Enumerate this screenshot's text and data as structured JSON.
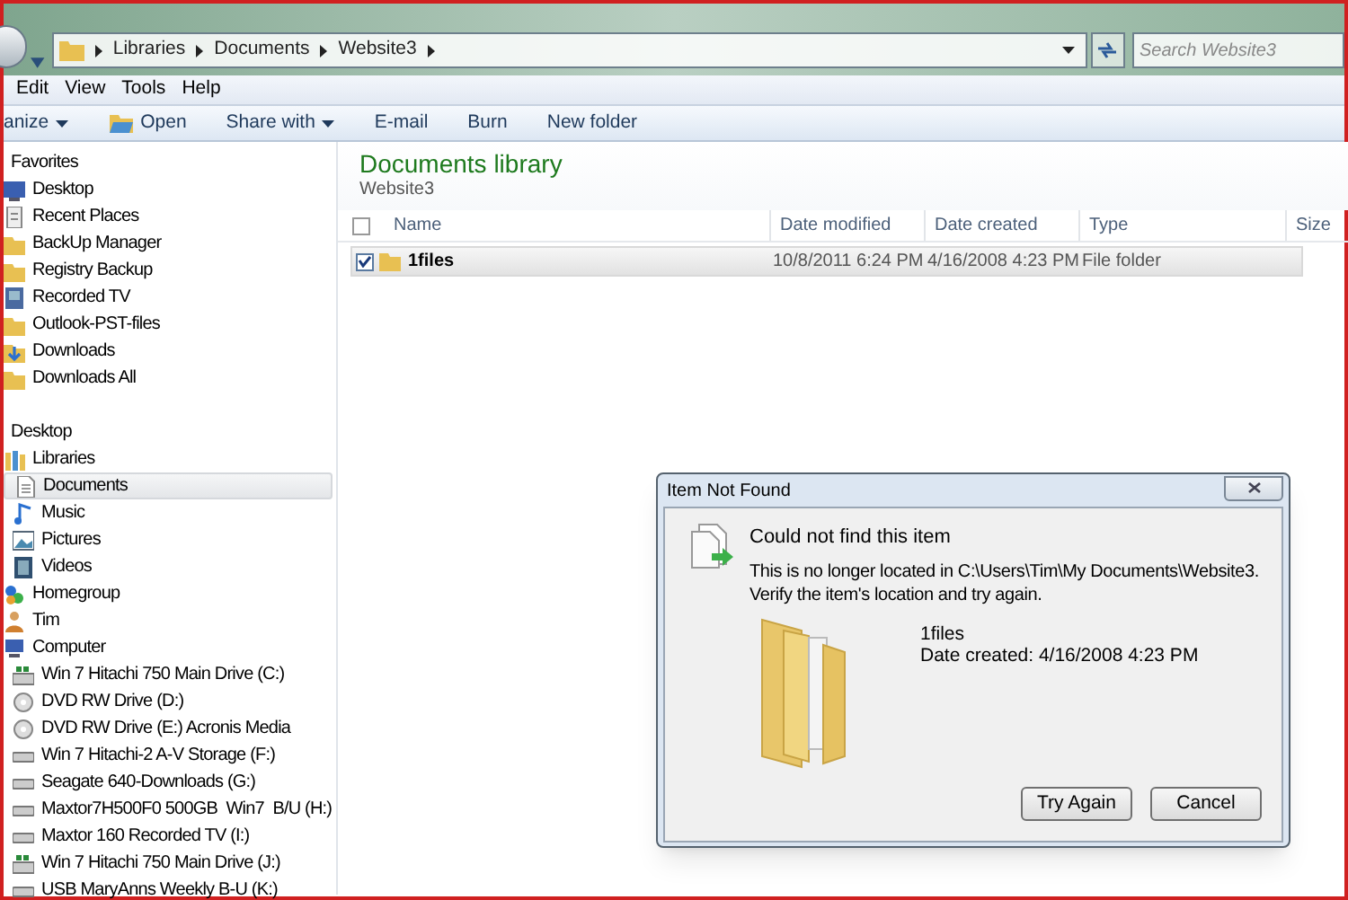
{
  "address_bar": {
    "crumbs": [
      "Libraries",
      "Documents",
      "Website3"
    ]
  },
  "search": {
    "placeholder": "Search Website3"
  },
  "menu_bar": [
    "Edit",
    "View",
    "Tools",
    "Help"
  ],
  "toolbar": [
    {
      "label": "anize",
      "dropdown": true,
      "kind": "plain"
    },
    {
      "label": "Open",
      "dropdown": false,
      "kind": "open"
    },
    {
      "label": "Share with",
      "dropdown": true,
      "kind": "plain"
    },
    {
      "label": "E-mail",
      "dropdown": false,
      "kind": "plain"
    },
    {
      "label": "Burn",
      "dropdown": false,
      "kind": "plain"
    },
    {
      "label": "New folder",
      "dropdown": false,
      "kind": "plain"
    }
  ],
  "sidebar": [
    {
      "label": "Favorites",
      "selected": false,
      "children": [
        {
          "label": "Desktop",
          "kind": "desktop",
          "selected": false
        },
        {
          "label": "Recent Places",
          "kind": "recent",
          "selected": false
        },
        {
          "label": "BackUp Manager",
          "kind": "folder",
          "selected": false
        },
        {
          "label": "Registry Backup",
          "kind": "folder",
          "selected": false
        },
        {
          "label": "Recorded TV",
          "kind": "tv",
          "selected": false
        },
        {
          "label": "Outlook-PST-files",
          "kind": "folder",
          "selected": false
        },
        {
          "label": "Downloads",
          "kind": "download",
          "selected": false
        },
        {
          "label": "Downloads All",
          "kind": "folder",
          "selected": false
        }
      ]
    },
    {
      "label": "Desktop",
      "selected": false,
      "children": [
        {
          "label": "Libraries",
          "kind": "library",
          "selected": false,
          "children": [
            {
              "label": "Documents",
              "kind": "document",
              "selected": true
            },
            {
              "label": "Music",
              "kind": "music",
              "selected": false
            },
            {
              "label": "Pictures",
              "kind": "picture",
              "selected": false
            },
            {
              "label": "Videos",
              "kind": "video",
              "selected": false
            }
          ]
        },
        {
          "label": "Homegroup",
          "kind": "network",
          "selected": false
        },
        {
          "label": "Tim",
          "kind": "user",
          "selected": false
        },
        {
          "label": "Computer",
          "kind": "computer",
          "selected": false,
          "children": [
            {
              "label": "Win 7 Hitachi 750 Main Drive (C:)",
              "kind": "system-drive",
              "selected": false
            },
            {
              "label": "DVD RW Drive (D:)",
              "kind": "disc",
              "selected": false
            },
            {
              "label": "DVD RW Drive (E:) Acronis Media",
              "kind": "disc",
              "selected": false
            },
            {
              "label": "Win 7 Hitachi-2 A-V Storage (F:)",
              "kind": "drive",
              "selected": false
            },
            {
              "label": "Seagate 640-Downloads (G:)",
              "kind": "drive",
              "selected": false
            },
            {
              "label": "Maxtor7H500F0 500GB  Win7  B/U (H:)",
              "kind": "drive",
              "selected": false
            },
            {
              "label": "Maxtor 160 Recorded TV (I:)",
              "kind": "drive",
              "selected": false
            },
            {
              "label": "Win 7 Hitachi 750 Main Drive (J:)",
              "kind": "system-drive",
              "selected": false
            },
            {
              "label": "USB MaryAnns Weekly B-U (K:)",
              "kind": "drive",
              "selected": false
            }
          ]
        }
      ]
    }
  ],
  "library": {
    "title": "Documents library",
    "subtitle": "Website3"
  },
  "table": {
    "header_checked": false,
    "columns": [
      "Name",
      "Date modified",
      "Date created",
      "Type",
      "Size"
    ],
    "rows": [
      {
        "cells": [
          "1files",
          "10/8/2011 6:24 PM",
          "4/16/2008 4:23 PM",
          "File folder"
        ],
        "checked": true,
        "selected": true
      }
    ]
  },
  "dialog": {
    "title": "Item Not Found",
    "heading": "Could not find this item",
    "message": "This is no longer located in C:\\Users\\Tim\\My Documents\\Website3. Verify the item's location and try again.",
    "item_name": "1files",
    "item_detail": "Date created: 4/16/2008 4:23 PM",
    "buttons": [
      "Try Again",
      "Cancel"
    ]
  }
}
